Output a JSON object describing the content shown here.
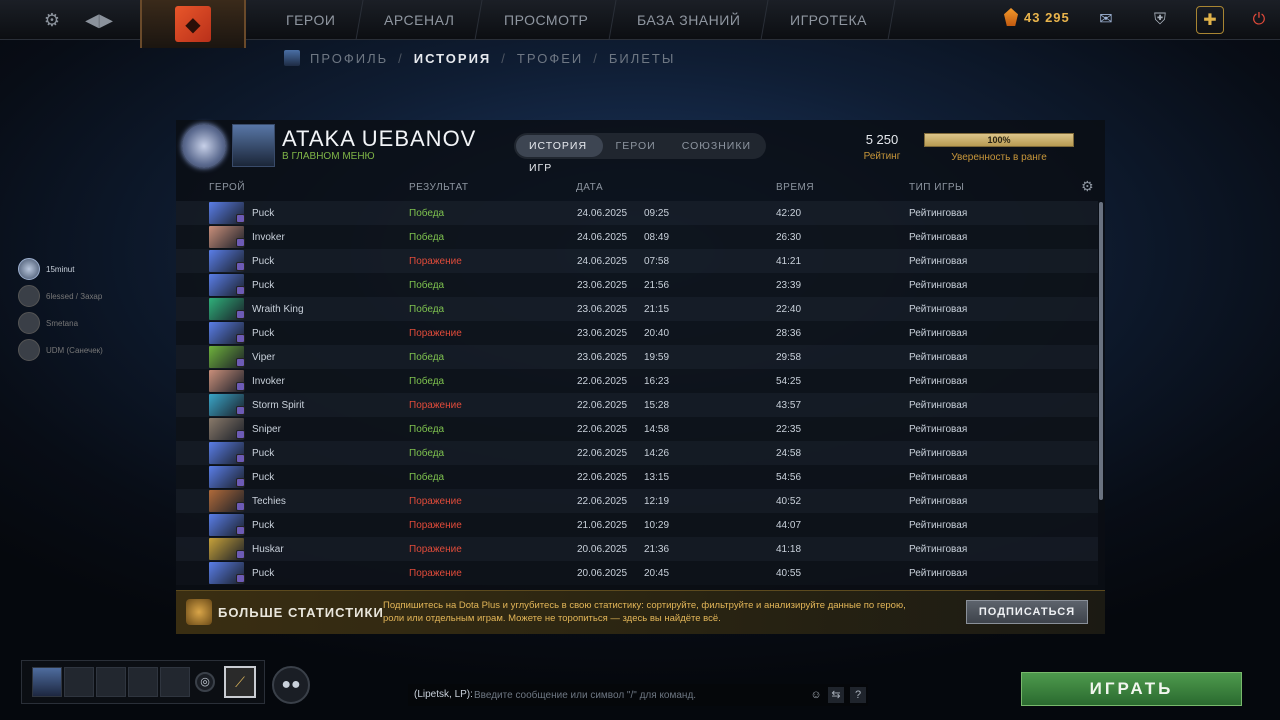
{
  "topbar": {
    "settings_icon": "gear-icon",
    "nav": [
      "ГЕРОИ",
      "АРСЕНАЛ",
      "ПРОСМОТР",
      "БАЗА ЗНАНИЙ",
      "ИГРОТЕКА"
    ],
    "shards": "43 295"
  },
  "subnav": {
    "profile": "ПРОФИЛЬ",
    "history": "ИСТОРИЯ",
    "trophies": "ТРОФЕИ",
    "tickets": "БИЛЕТЫ",
    "sep": "/"
  },
  "player": {
    "name": "ATAKA UEBANOV",
    "status": "В ГЛАВНОМ МЕНЮ"
  },
  "tabs": [
    "ИСТОРИЯ ИГР",
    "ГЕРОИ",
    "СОЮЗНИКИ"
  ],
  "rating": {
    "value": "5 250",
    "label": "Рейтинг"
  },
  "confidence": {
    "value": "100%",
    "label": "Уверенность в ранге",
    "fill": 1.0
  },
  "columns": {
    "hero": "ГЕРОЙ",
    "result": "РЕЗУЛЬТАТ",
    "date": "ДАТА",
    "duration": "ВРЕМЯ",
    "type": "ТИП ИГРЫ"
  },
  "matches": [
    {
      "hero": "Puck",
      "result": "Победа",
      "win": true,
      "date": "24.06.2025",
      "time": "09:25",
      "duration": "42:20",
      "type": "Рейтинговая"
    },
    {
      "hero": "Invoker",
      "result": "Победа",
      "win": true,
      "date": "24.06.2025",
      "time": "08:49",
      "duration": "26:30",
      "type": "Рейтинговая"
    },
    {
      "hero": "Puck",
      "result": "Поражение",
      "win": false,
      "date": "24.06.2025",
      "time": "07:58",
      "duration": "41:21",
      "type": "Рейтинговая"
    },
    {
      "hero": "Puck",
      "result": "Победа",
      "win": true,
      "date": "23.06.2025",
      "time": "21:56",
      "duration": "23:39",
      "type": "Рейтинговая"
    },
    {
      "hero": "Wraith King",
      "result": "Победа",
      "win": true,
      "date": "23.06.2025",
      "time": "21:15",
      "duration": "22:40",
      "type": "Рейтинговая"
    },
    {
      "hero": "Puck",
      "result": "Поражение",
      "win": false,
      "date": "23.06.2025",
      "time": "20:40",
      "duration": "28:36",
      "type": "Рейтинговая"
    },
    {
      "hero": "Viper",
      "result": "Победа",
      "win": true,
      "date": "23.06.2025",
      "time": "19:59",
      "duration": "29:58",
      "type": "Рейтинговая"
    },
    {
      "hero": "Invoker",
      "result": "Победа",
      "win": true,
      "date": "22.06.2025",
      "time": "16:23",
      "duration": "54:25",
      "type": "Рейтинговая"
    },
    {
      "hero": "Storm Spirit",
      "result": "Поражение",
      "win": false,
      "date": "22.06.2025",
      "time": "15:28",
      "duration": "43:57",
      "type": "Рейтинговая"
    },
    {
      "hero": "Sniper",
      "result": "Победа",
      "win": true,
      "date": "22.06.2025",
      "time": "14:58",
      "duration": "22:35",
      "type": "Рейтинговая"
    },
    {
      "hero": "Puck",
      "result": "Победа",
      "win": true,
      "date": "22.06.2025",
      "time": "14:26",
      "duration": "24:58",
      "type": "Рейтинговая"
    },
    {
      "hero": "Puck",
      "result": "Победа",
      "win": true,
      "date": "22.06.2025",
      "time": "13:15",
      "duration": "54:56",
      "type": "Рейтинговая"
    },
    {
      "hero": "Techies",
      "result": "Поражение",
      "win": false,
      "date": "22.06.2025",
      "time": "12:19",
      "duration": "40:52",
      "type": "Рейтинговая"
    },
    {
      "hero": "Puck",
      "result": "Поражение",
      "win": false,
      "date": "21.06.2025",
      "time": "10:29",
      "duration": "44:07",
      "type": "Рейтинговая"
    },
    {
      "hero": "Huskar",
      "result": "Поражение",
      "win": false,
      "date": "20.06.2025",
      "time": "21:36",
      "duration": "41:18",
      "type": "Рейтинговая"
    },
    {
      "hero": "Puck",
      "result": "Поражение",
      "win": false,
      "date": "20.06.2025",
      "time": "20:45",
      "duration": "40:55",
      "type": "Рейтинговая"
    }
  ],
  "hero_colors": {
    "Puck": "#5a7ee8",
    "Invoker": "#c98f7a",
    "Wraith King": "#2fb07a",
    "Viper": "#6fb23c",
    "Storm Spirit": "#3aa6c8",
    "Sniper": "#8a7a6a",
    "Techies": "#b06a3a",
    "Huskar": "#c7a23a"
  },
  "promo": {
    "title": "БОЛЬШЕ СТАТИСТИКИ",
    "text": "Подпишитесь на Dota Plus и углубитесь в свою статистику: сортируйте, фильтруйте и анализируйте данные по герою, роли или отдельным играм. Можете не торопиться — здесь вы найдёте всё.",
    "button": "ПОДПИСАТЬСЯ"
  },
  "friends": [
    "15minut",
    "6lessed / Захар",
    "Smetana",
    "UDM (Санечек)"
  ],
  "chat": {
    "channel": "(Lipetsk, LP):",
    "placeholder": "Введите сообщение или символ \"/\" для команд.",
    "help": "?"
  },
  "play_button": "ИГРАТЬ"
}
